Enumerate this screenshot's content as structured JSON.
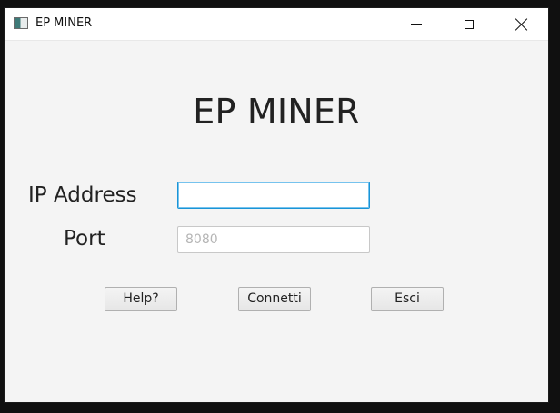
{
  "window": {
    "title": "EP MINER"
  },
  "main": {
    "heading": "EP MINER",
    "ip_address_label": "IP Address",
    "ip_address_value": "",
    "port_label": "Port",
    "port_value": "",
    "port_placeholder": "8080"
  },
  "buttons": {
    "help": "Help?",
    "connect": "Connetti",
    "exit": "Esci"
  },
  "icons": {
    "app": "window-app-icon",
    "minimize": "minimize-icon",
    "maximize": "maximize-icon",
    "close": "close-icon"
  },
  "colors": {
    "focused_input_border": "#1a94d6",
    "background": "#f4f4f4",
    "titlebar": "#ffffff"
  }
}
